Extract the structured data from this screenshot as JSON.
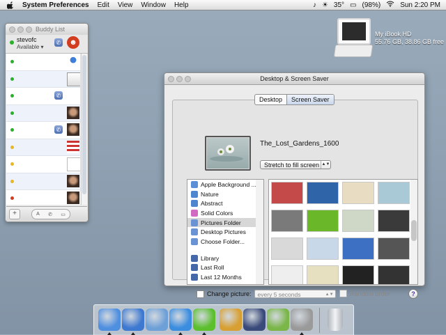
{
  "menubar": {
    "app_name": "System Preferences",
    "items": [
      "Edit",
      "View",
      "Window",
      "Help"
    ],
    "temperature": "35°",
    "battery": "(98%)",
    "clock": "Sun 2:20 PM"
  },
  "desktop": {
    "drive_name": "My iBook HD",
    "drive_info": "55.76 GB, 38.86 GB free"
  },
  "buddy_list": {
    "title": "Buddy List",
    "user_name": "stevofc",
    "user_status": "Available",
    "buddies": [
      {
        "status_color": "#2bb02b",
        "phone": false,
        "avatar": "aim"
      },
      {
        "status_color": "#2bb02b",
        "phone": false,
        "avatar": "logo"
      },
      {
        "status_color": "#2bb02b",
        "phone": true,
        "avatar": "none"
      },
      {
        "status_color": "#2bb02b",
        "phone": false,
        "avatar": "face"
      },
      {
        "status_color": "#2bb02b",
        "phone": true,
        "avatar": "face"
      },
      {
        "status_color": "#e6b823",
        "phone": false,
        "avatar": "flag"
      },
      {
        "status_color": "#e6b823",
        "phone": false,
        "avatar": "text"
      },
      {
        "status_color": "#e6b823",
        "phone": false,
        "avatar": "face"
      },
      {
        "status_color": "#d23c1f",
        "phone": false,
        "avatar": "face"
      },
      {
        "status_color": "#d23c1f",
        "phone": true,
        "avatar": "face"
      }
    ]
  },
  "window": {
    "title": "Desktop & Screen Saver",
    "tabs": [
      "Desktop",
      "Screen Saver"
    ],
    "selected_tab": "Screen Saver",
    "picture_name": "The_Lost_Gardens_1600",
    "fit_option": "Stretch to fill screen",
    "sources": [
      {
        "label": "Apple Background ...",
        "color": "#5b8fd6",
        "selected": false
      },
      {
        "label": "Nature",
        "color": "#4f86d0",
        "selected": false
      },
      {
        "label": "Abstract",
        "color": "#4f86d0",
        "selected": false
      },
      {
        "label": "Solid Colors",
        "color": "#d06bc1",
        "selected": false
      },
      {
        "label": "Pictures Folder",
        "color": "#6a93d4",
        "selected": true
      },
      {
        "label": "Desktop Pictures",
        "color": "#6a93d4",
        "selected": false
      },
      {
        "label": "Choose Folder...",
        "color": "#6a93d4",
        "selected": false
      }
    ],
    "iphoto_sources": [
      {
        "label": "Library",
        "color": "#4568a8"
      },
      {
        "label": "Last Roll",
        "color": "#4568a8"
      },
      {
        "label": "Last 12 Months",
        "color": "#4568a8"
      }
    ],
    "thumbnail_colors": [
      "#c44a4a",
      "#2f64a8",
      "#e8dcc2",
      "#a9c9d6",
      "#7a7a7a",
      "#6ab82a",
      "#cfd8c6",
      "#3a3a3a",
      "#d9d9d9",
      "#c8d8e8",
      "#3d6fc2",
      "#555555",
      "#eeeeee",
      "#e7e0c0",
      "#222222",
      "#333333"
    ],
    "change_picture_label": "Change picture:",
    "interval": "every 5 seconds",
    "random_label": "Random order",
    "help": "?"
  },
  "dock": {
    "apps": [
      {
        "name": "finder-icon",
        "color": "#4f8fe0"
      },
      {
        "name": "safari-icon",
        "color": "#3d78d1"
      },
      {
        "name": "mail-icon",
        "color": "#6ea0d8"
      },
      {
        "name": "ichat-icon",
        "color": "#3b8de0"
      },
      {
        "name": "adium-icon",
        "color": "#5bbf2e"
      },
      {
        "name": "pen-icon",
        "color": "#d8a032"
      },
      {
        "name": "quill-icon",
        "color": "#3a4a7a"
      },
      {
        "name": "itunes-icon",
        "color": "#7ab648"
      },
      {
        "name": "system-preferences-icon",
        "color": "#9a9a9a"
      },
      {
        "name": "trash-icon",
        "color": "#d8dde2"
      }
    ]
  }
}
